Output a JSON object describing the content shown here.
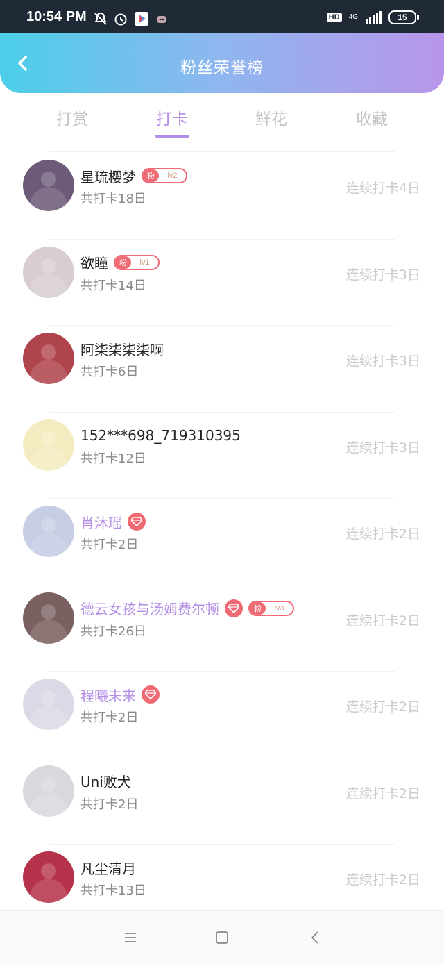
{
  "status_bar": {
    "time": "10:54 PM",
    "hd": "HD",
    "network": "4G",
    "battery": "15"
  },
  "header": {
    "title": "粉丝荣誉榜"
  },
  "tabs": [
    {
      "label": "打赏"
    },
    {
      "label": "打卡"
    },
    {
      "label": "鲜花"
    },
    {
      "label": "收藏"
    }
  ],
  "active_tab": "打卡",
  "colors": {
    "accent": "#b48fe6",
    "badge_red": "#ef6a74",
    "header_gradient_start": "#4bcfe8",
    "header_gradient_end": "#b895e9"
  },
  "fans": [
    {
      "name": "星琉樱梦",
      "vip": false,
      "fan_badge": {
        "label": "粉",
        "level": "lv2"
      },
      "total": "共打卡18日",
      "streak": "连续打卡4日",
      "avatar_color": "#6c5a78"
    },
    {
      "name": "欲瞳",
      "vip": false,
      "fan_badge": {
        "label": "粉",
        "level": "lv1"
      },
      "total": "共打卡14日",
      "streak": "连续打卡3日",
      "avatar_color": "#d8cdd3"
    },
    {
      "name": "阿柒柒柒柒啊",
      "vip": false,
      "fan_badge": null,
      "total": "共打卡6日",
      "streak": "连续打卡3日",
      "avatar_color": "#b0444c"
    },
    {
      "name": "152***698_719310395",
      "vip": false,
      "fan_badge": null,
      "total": "共打卡12日",
      "streak": "连续打卡3日",
      "avatar_color": "#f4ecc0"
    },
    {
      "name": "肖沐瑶",
      "vip": true,
      "fan_badge": null,
      "total": "共打卡2日",
      "streak": "连续打卡2日",
      "avatar_color": "#c7cde3"
    },
    {
      "name": "德云女孩与汤姆费尔顿",
      "vip": true,
      "fan_badge": {
        "label": "粉",
        "level": "lv3"
      },
      "total": "共打卡26日",
      "streak": "连续打卡2日",
      "avatar_color": "#7a6060"
    },
    {
      "name": "程曦未来",
      "vip": true,
      "fan_badge": null,
      "total": "共打卡2日",
      "streak": "连续打卡2日",
      "avatar_color": "#dcd8e6"
    },
    {
      "name": "Uni败犬",
      "vip": false,
      "fan_badge": null,
      "total": "共打卡2日",
      "streak": "连续打卡2日",
      "avatar_color": "#d9d9dd"
    },
    {
      "name": "凡尘清月",
      "vip": false,
      "fan_badge": null,
      "total": "共打卡13日",
      "streak": "连续打卡2日",
      "avatar_color": "#b5334a"
    }
  ]
}
